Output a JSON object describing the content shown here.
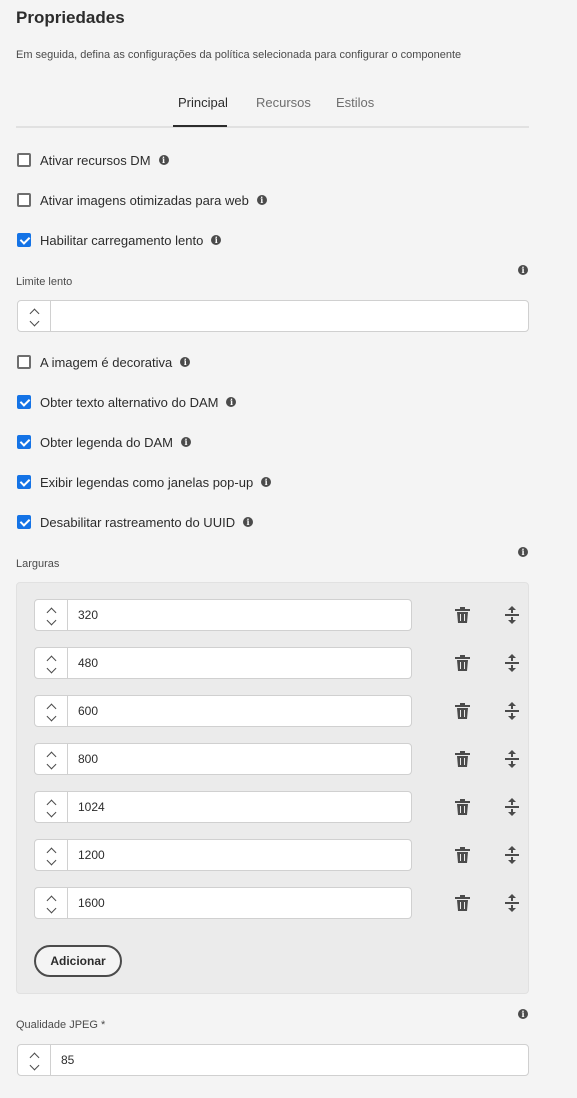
{
  "header": {
    "title": "Propriedades",
    "subtitle": "Em seguida, defina as configurações da política selecionada para configurar o componente"
  },
  "tabs": [
    {
      "label": "Principal",
      "active": true
    },
    {
      "label": "Recursos",
      "active": false
    },
    {
      "label": "Estilos",
      "active": false
    }
  ],
  "options_top": [
    {
      "label": "Ativar recursos DM",
      "checked": false
    },
    {
      "label": "Ativar imagens otimizadas para web",
      "checked": false
    },
    {
      "label": "Habilitar carregamento lento",
      "checked": true
    }
  ],
  "lazy_threshold": {
    "label": "Limite lento",
    "value": ""
  },
  "options_mid": [
    {
      "label": "A imagem é decorativa",
      "checked": false
    },
    {
      "label": "Obter texto alternativo do DAM",
      "checked": true
    },
    {
      "label": "Obter legenda do DAM",
      "checked": true
    },
    {
      "label": "Exibir legendas como janelas pop-up",
      "checked": true
    },
    {
      "label": "Desabilitar rastreamento do UUID",
      "checked": true
    }
  ],
  "widths": {
    "label": "Larguras",
    "values": [
      "320",
      "480",
      "600",
      "800",
      "1024",
      "1200",
      "1600"
    ],
    "add_label": "Adicionar"
  },
  "jpeg_quality": {
    "label": "Qualidade JPEG *",
    "value": "85"
  },
  "info_glyph": "i",
  "colors": {
    "accent": "#1473e6",
    "background": "#f4f4f4"
  }
}
